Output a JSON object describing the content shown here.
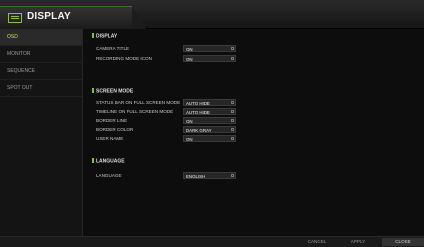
{
  "window": {
    "title": "DISPLAY",
    "icon": "display-icon"
  },
  "sidebar": {
    "items": [
      {
        "label": "OSD",
        "active": true
      },
      {
        "label": "MONITOR",
        "active": false
      },
      {
        "label": "SEQUENCE",
        "active": false
      },
      {
        "label": "SPOT OUT",
        "active": false
      }
    ]
  },
  "sections": {
    "display": {
      "title": "DISPLAY",
      "rows": [
        {
          "label": "CAMERA TITLE",
          "value": "ON"
        },
        {
          "label": "RECORDING MODE ICON",
          "value": "ON"
        }
      ]
    },
    "screen_mode": {
      "title": "SCREEN MODE",
      "rows": [
        {
          "label": "STATUS BAR ON FULL SCREEN MODE",
          "value": "AUTO HIDE"
        },
        {
          "label": "TIMELINE ON FULL SCREEN MODE",
          "value": "AUTO HIDE"
        },
        {
          "label": "BORDER LINE",
          "value": "ON"
        },
        {
          "label": "BORDER COLOR",
          "value": "DARK GRAY"
        },
        {
          "label": "USER NAME",
          "value": "ON"
        }
      ]
    },
    "language": {
      "title": "LANGUAGE",
      "rows": [
        {
          "label": "LANGUAGE",
          "value": "ENGLISH"
        }
      ]
    }
  },
  "footer": {
    "cancel_label": "CANCEL",
    "apply_label": "APPLY",
    "close_label": "CLOSE"
  },
  "colors": {
    "accent": "#7cc23a",
    "active_text": "#b9e35a"
  }
}
